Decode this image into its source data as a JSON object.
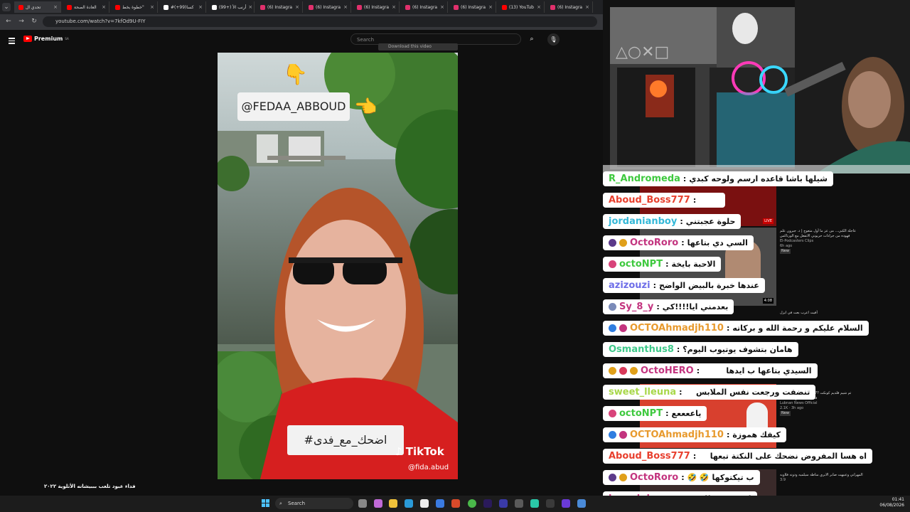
{
  "browser": {
    "tabs": [
      {
        "title": "تحدي ال",
        "color": "#ff0000"
      },
      {
        "title": "العادة الصحة",
        "color": "#ff0000"
      },
      {
        "title": "خطوة بخط\"",
        "color": "#ff0000"
      },
      {
        "title": "#كسا(99+)",
        "color": "#ffffff"
      },
      {
        "title": "(99+) أرنب الأ",
        "color": "#ffffff"
      },
      {
        "title": "(6) Instagra",
        "color": "#e1306c"
      },
      {
        "title": "(6) Instagra",
        "color": "#e1306c"
      },
      {
        "title": "(6) Instagra",
        "color": "#e1306c"
      },
      {
        "title": "(6) Instagra",
        "color": "#e1306c"
      },
      {
        "title": "(6) Instagra",
        "color": "#e1306c"
      },
      {
        "title": "(13) YouTub",
        "color": "#ff0000"
      },
      {
        "title": "(6) Instagra",
        "color": "#e1306c"
      }
    ],
    "url": "youtube.com/watch?v=7kfOd9U-FIY"
  },
  "youtube": {
    "logo": "Premium",
    "region": "SA",
    "search_placeholder": "Search",
    "download_label": "Download this video",
    "video_title": "فداء عبود تلعب بببيشانه الأثلوية ٢٠٢٢"
  },
  "video": {
    "handle": "@FEDAA_ABBOUD",
    "hashtag": "#اضحك_مع_فدى",
    "brand": "TikTok",
    "brand_handle": "@fida.abud"
  },
  "chat": [
    {
      "user": "R_Andromeda",
      "color": "#3ec93e",
      "message": "شيلها باشا قاعده ارسم ولوحه كبدي",
      "badges": [],
      "emotes": ""
    },
    {
      "user": "Aboud_Boss777",
      "color": "#e8402e",
      "message": "",
      "badges": [],
      "emotes": "😂 😂"
    },
    {
      "user": "jordanianboy",
      "color": "#34b8d8",
      "message": "حلوة عجبتني",
      "badges": [],
      "emotes": ""
    },
    {
      "user": "OctoRoro",
      "color": "#c3347f",
      "message": "السي دي بتاعها",
      "badges": [
        "#5c3a8a",
        "#e0a01a"
      ],
      "emotes": ""
    },
    {
      "user": "octoNPT",
      "color": "#3ec93e",
      "message": "الاحبة بايخة",
      "badges": [
        "#d8437a"
      ],
      "emotes": ""
    },
    {
      "user": "azizouzi",
      "color": "#6e6ee8",
      "message": "عندها خبرة بالبيض الواضح",
      "badges": [],
      "emotes": ""
    },
    {
      "user": "Sy_8_y",
      "color": "#c3347f",
      "message": "بعدمني ايا!!!!كي",
      "badges": [
        "#7a8ab8"
      ],
      "emotes": ""
    },
    {
      "user": "OCTOAhmadjh110",
      "color": "#e89a2e",
      "message": "السلام عليكم و رحمة الله و بركاته",
      "badges": [
        "#2f7de0",
        "#c3347f"
      ],
      "emotes": ""
    },
    {
      "user": "Osmanthus8",
      "color": "#3ec98a",
      "message": "هامان بتشوف يوتيوب اليوم؟",
      "badges": [],
      "emotes": ""
    },
    {
      "user": "OctoHERO",
      "color": "#c3347f",
      "message": "السيدي بتاعها ب ايدها",
      "badges": [
        "#e0a01a",
        "#d83a5a",
        "#e0a01a"
      ],
      "emotes": "😂 😂"
    },
    {
      "user": "sweet_lleuna",
      "color": "#a8d84a",
      "message": "تنضفت ورجعت نفس الملابس",
      "badges": [],
      "emotes": "😜"
    },
    {
      "user": "octoNPT",
      "color": "#3ec93e",
      "message": "ياععععع",
      "badges": [
        "#d8437a"
      ],
      "emotes": ""
    },
    {
      "user": "OCTOAhmadjh110",
      "color": "#e89a2e",
      "message": "كيفك هموزة",
      "badges": [
        "#2f7de0",
        "#c3347f"
      ],
      "emotes": ""
    },
    {
      "user": "Aboud_Boss777",
      "color": "#e8402e",
      "message": "اه هسا المفروض نضحك على النكتة تبعها",
      "badges": [],
      "emotes": "😒"
    },
    {
      "user": "OctoRoro",
      "color": "#c3347f",
      "message": "ب تيكتوكها",
      "badges": [
        "#5c3a8a",
        "#e0a01a"
      ],
      "emotes": "🤣 🤣"
    },
    {
      "user": "kamalghanem",
      "color": "#c3347f",
      "message": "ازئ فيديو لليوم",
      "badges": [],
      "emotes": ""
    }
  ],
  "taskbar": {
    "search_label": "Search",
    "time": "01:41",
    "date": "06/08/2026"
  },
  "sidebar_overlay": {
    "card1_title": "عاجلة الكبي... من عز ما أول متعوج | د. جبرون علم",
    "card1_sub": "فهوده من جرادات حريوني الانفعل مع الورتاكس",
    "card1_channel": "El-Podcasters Clips",
    "card1_meta": "6h ago",
    "card1_badge": "New",
    "card2_title": "ثم شيم قلديم كونكت ??? شلكاء السسموج فري",
    "card2_sub": "فاري لحد الفرج على ليزر",
    "card2_channel": "Lubnan News Official",
    "card2_meta": "2.1K · 3h ago",
    "card2_badge": "New",
    "card3_title": "المهراني وعبيهت صابر الابري مناطه سيلميه ودونه فلاويه",
    "card3_meta": "3:9",
    "caption_text": "أفيت اعرب بعت في ايزل"
  }
}
